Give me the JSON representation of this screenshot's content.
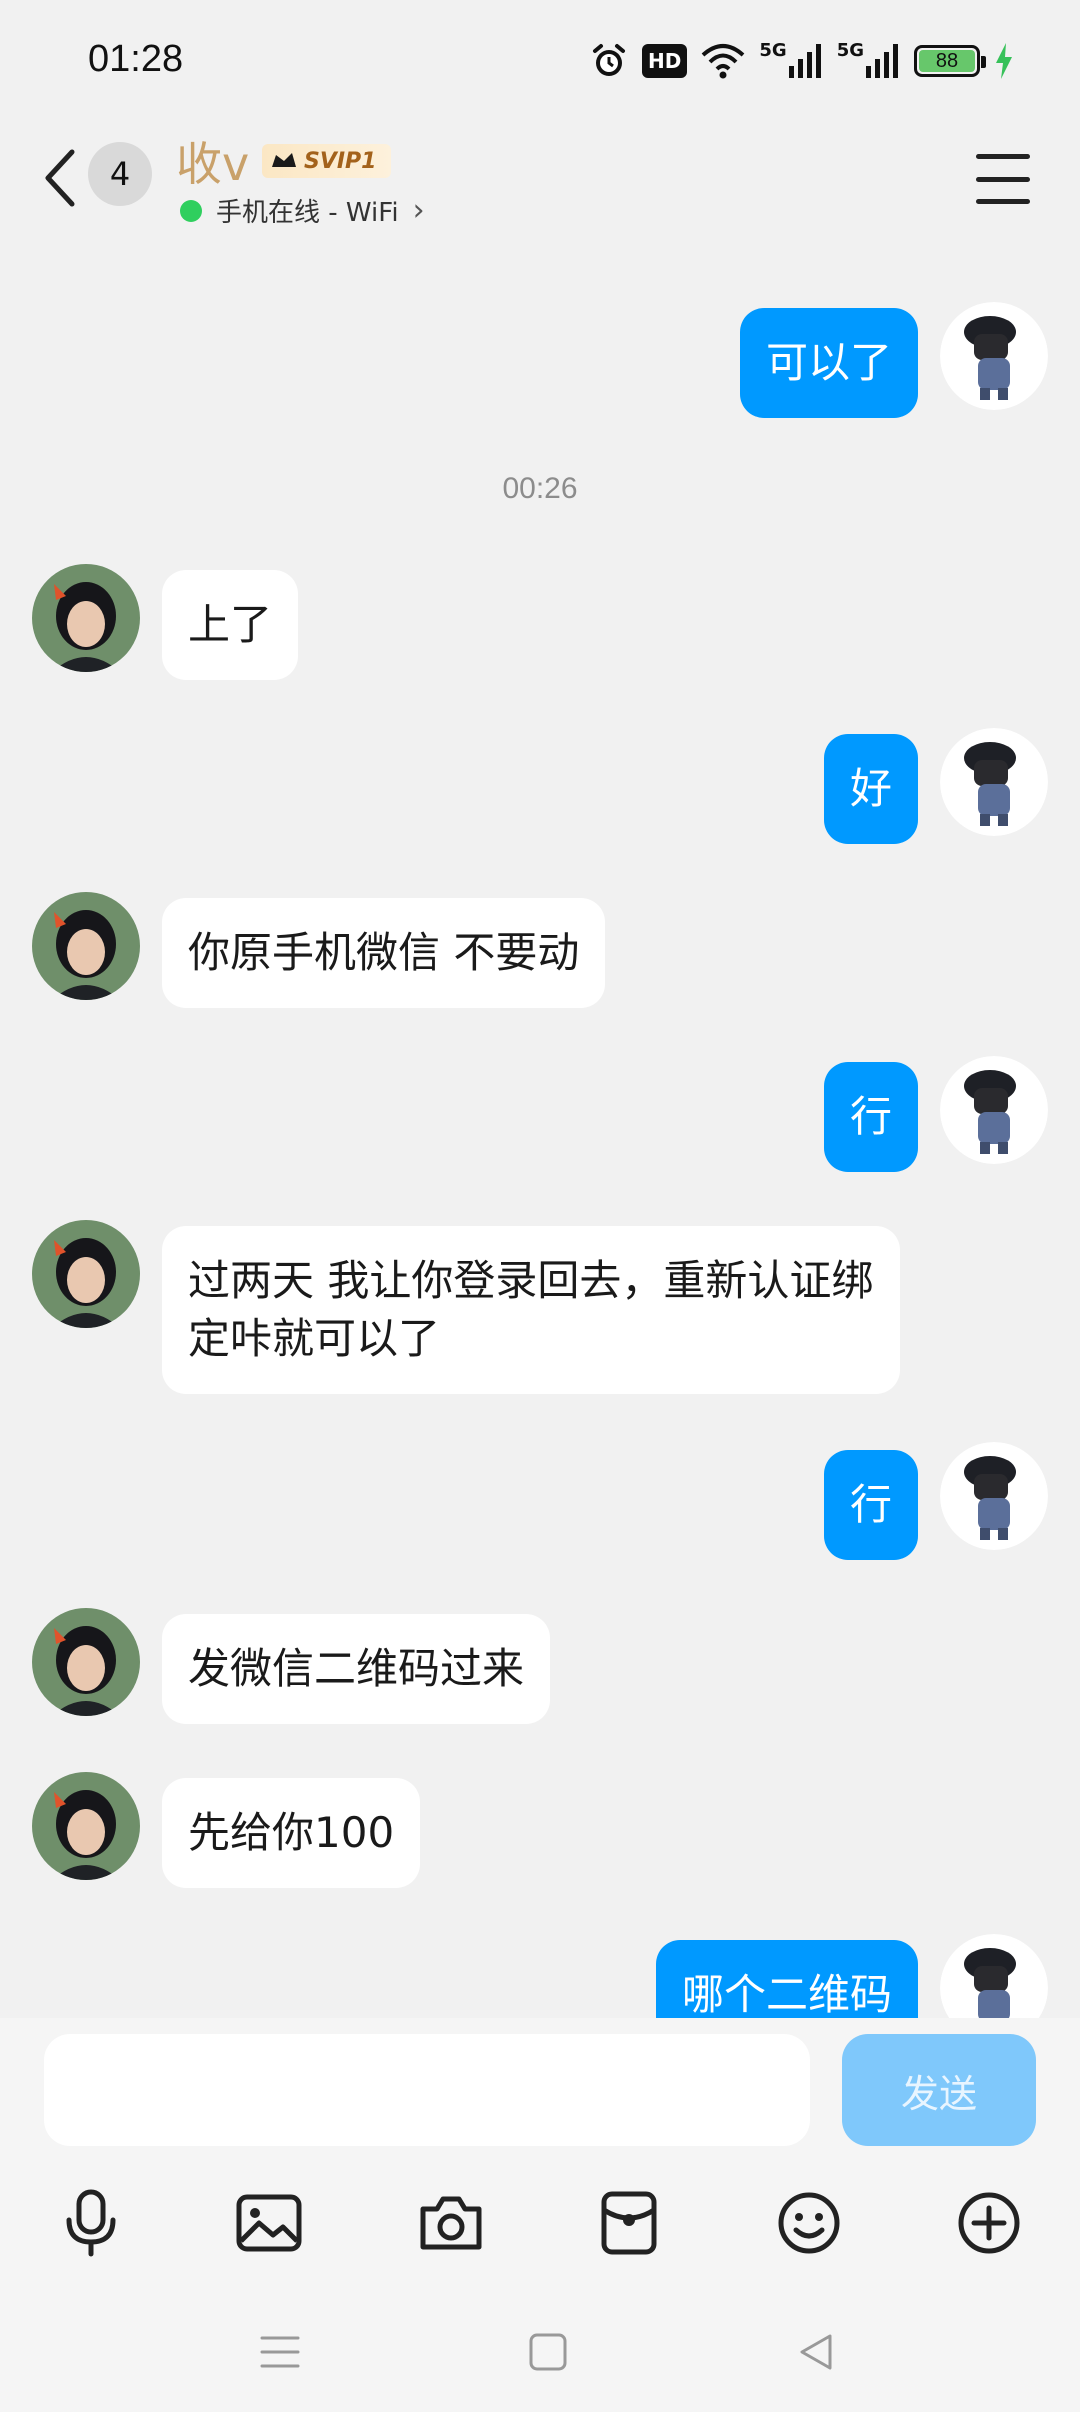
{
  "status_bar": {
    "time": "01:28",
    "hd_label": "HD",
    "net1": "5G",
    "net2": "5G",
    "battery": "88"
  },
  "header": {
    "unread_count": "4",
    "contact_name": "收v",
    "vip_label": "SVIP1",
    "online_status": "手机在线 - WiFi",
    "chevron": "›"
  },
  "chat": {
    "timestamp": "00:26",
    "messages": [
      {
        "dir": "out",
        "text": "可以了"
      },
      {
        "dir": "in",
        "text": "上了"
      },
      {
        "dir": "out",
        "text": "好"
      },
      {
        "dir": "in",
        "text": "你原手机微信  不要动"
      },
      {
        "dir": "out",
        "text": "行"
      },
      {
        "dir": "in",
        "text": "过两天  我让你登录回去，重新认证绑定咔就可以了"
      },
      {
        "dir": "out",
        "text": "行"
      },
      {
        "dir": "in",
        "text": "发微信二维码过来"
      },
      {
        "dir": "in",
        "text": "先给你100"
      },
      {
        "dir": "out",
        "text": "哪个二维码"
      }
    ]
  },
  "input": {
    "value": "",
    "send_label": "发送"
  },
  "toolbar": {
    "icons": [
      "microphone-icon",
      "image-icon",
      "camera-icon",
      "red-packet-icon",
      "emoji-icon",
      "plus-icon"
    ]
  },
  "colors": {
    "outgoing_bubble": "#0099ff",
    "incoming_bubble": "#ffffff",
    "name": "#c9a16a",
    "online": "#2fcf5e",
    "send_disabled": "#7fc8fb"
  }
}
